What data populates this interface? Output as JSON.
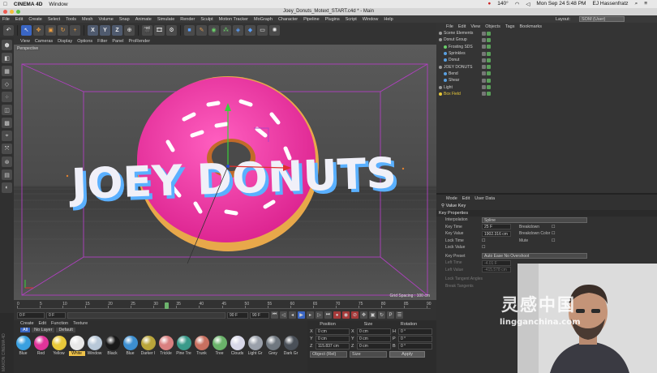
{
  "mac_menubar": {
    "app": "CINEMA 4D",
    "items": [
      "Window"
    ],
    "status_temp": "140°",
    "clock": "Mon Sep 24 5:48 PM",
    "user": "EJ Hassenfratz"
  },
  "window": {
    "title": "Joey_Donuts_Motext_START.c4d * - Main"
  },
  "menubar": {
    "items": [
      "File",
      "Edit",
      "Create",
      "Select",
      "Tools",
      "Mesh",
      "Volume",
      "Snap",
      "Animate",
      "Simulate",
      "Render",
      "Sculpt",
      "Motion Tracker",
      "MoGraph",
      "Character",
      "Pipeline",
      "Plugins",
      "Script",
      "Window",
      "Help"
    ],
    "layout_label": "Layout:",
    "layout_value": "SOM (User)"
  },
  "toolbar": {
    "axis_x": "X",
    "axis_y": "Y",
    "axis_z": "Z"
  },
  "viewport": {
    "menu": [
      "View",
      "Cameras",
      "Display",
      "Options",
      "Filter",
      "Panel",
      "ProRender"
    ],
    "label": "Perspective",
    "grid_spacing": "Grid Spacing : 100 cm",
    "text_3d": "JOEY DONUTS"
  },
  "timeline": {
    "ticks": [
      "0",
      "5",
      "10",
      "15",
      "20",
      "25",
      "30",
      "35",
      "40",
      "45",
      "50",
      "55",
      "60",
      "65",
      "70",
      "75",
      "80",
      "85",
      "90"
    ],
    "current_frame_fraction": 0.36,
    "start_field": "0 F",
    "min_field": "0 F",
    "max_field": "90 F",
    "end_field": "90 F",
    "end_label": "60 F"
  },
  "materials": {
    "tabs": [
      "Create",
      "Edit",
      "Function",
      "Texture"
    ],
    "filters": [
      "All",
      "No Layer",
      "Default"
    ],
    "items": [
      {
        "label": "Blue",
        "color": "#3aa0e0"
      },
      {
        "label": "Red",
        "color": "#e0349a"
      },
      {
        "label": "Yellow",
        "color": "#e8c93a"
      },
      {
        "label": "White",
        "color": "#e8e8e8"
      },
      {
        "label": "Window",
        "color": "#b8c8d8"
      },
      {
        "label": "Black",
        "color": "#1a1a1a"
      },
      {
        "label": "Blue",
        "color": "#3d8fd0"
      },
      {
        "label": "Darker I",
        "color": "#b9a53a"
      },
      {
        "label": "Trickle",
        "color": "#d98080"
      },
      {
        "label": "Pine Tre",
        "color": "#3a9a8a"
      },
      {
        "label": "Trunk",
        "color": "#c87060"
      },
      {
        "label": "Tree",
        "color": "#6ab36a"
      },
      {
        "label": "Clouds",
        "color": "#d8d8e8"
      },
      {
        "label": "Light Gr",
        "color": "#9aa0aa"
      },
      {
        "label": "Grey",
        "color": "#707880"
      },
      {
        "label": "Dark Gr",
        "color": "#4a5058"
      }
    ]
  },
  "coordinates": {
    "headers": [
      "Position",
      "Size",
      "Rotation"
    ],
    "rows": [
      {
        "ax": "X",
        "pos": "0 cm",
        "ax2": "X",
        "size": "0 cm",
        "ax3": "H",
        "rot": "0 °"
      },
      {
        "ax": "Y",
        "pos": "0 cm",
        "ax2": "Y",
        "size": "0 cm",
        "ax3": "P",
        "rot": "0 °"
      },
      {
        "ax": "Z",
        "pos": "115.837 cm",
        "ax2": "Z",
        "size": "0 cm",
        "ax3": "B",
        "rot": "0 °"
      }
    ],
    "mode": "Object (Rel)",
    "size_mode": "Size",
    "apply": "Apply"
  },
  "object_manager": {
    "menu": [
      "File",
      "Edit",
      "View",
      "Objects",
      "Tags",
      "Bookmarks"
    ],
    "objects": [
      {
        "name": "Scene Elements",
        "indent": 0,
        "color": "#9a9a9a"
      },
      {
        "name": "Donut Group",
        "indent": 0,
        "color": "#9a9a9a"
      },
      {
        "name": "Frosting SDS",
        "indent": 1,
        "color": "#6ad06a"
      },
      {
        "name": "Sprinkles",
        "indent": 1,
        "color": "#5aa0e0"
      },
      {
        "name": "Donut",
        "indent": 1,
        "color": "#5aa0e0"
      },
      {
        "name": "JOEY DONUTS",
        "indent": 0,
        "color": "#9a9a9a"
      },
      {
        "name": "Bend",
        "indent": 1,
        "color": "#5aa0e0"
      },
      {
        "name": "Shear",
        "indent": 1,
        "color": "#5aa0e0"
      },
      {
        "name": "Light",
        "indent": 0,
        "color": "#9a9a9a"
      },
      {
        "name": "Box Field",
        "indent": 0,
        "color": "#e8c93a"
      }
    ]
  },
  "attribute_manager": {
    "menu": [
      "Mode",
      "Edit",
      "User Data"
    ],
    "title": "Value Key",
    "section": "Key Properties",
    "interpolation_label": "Interpolation",
    "interpolation_value": "Spline",
    "key_time_label": "Key Time",
    "key_time_value": "25 F",
    "key_value_label": "Key Value",
    "key_value_value": "1902.316 cm",
    "lock_time_label": "Lock Time",
    "lock_value_label": "Lock Value",
    "breakdown_label": "Breakdown",
    "breakdown_color_label": "Breakdown Color",
    "mute_label": "Mute",
    "key_preset_label": "Key Preset",
    "key_preset_value": "Auto Ease No Overshoot",
    "left_time_label": "Left Time",
    "left_time_value": "-4.01 F",
    "left_value_label": "Left Value",
    "left_value_value": "-415.578 cm",
    "lock_tangent_angles_label": "Lock Tangent Angles",
    "break_tangents_label": "Break Tangents"
  },
  "watermark": {
    "cn": "灵感中国",
    "url": "lingganchina.com"
  },
  "brand": "MAXON CINEMA 4D"
}
